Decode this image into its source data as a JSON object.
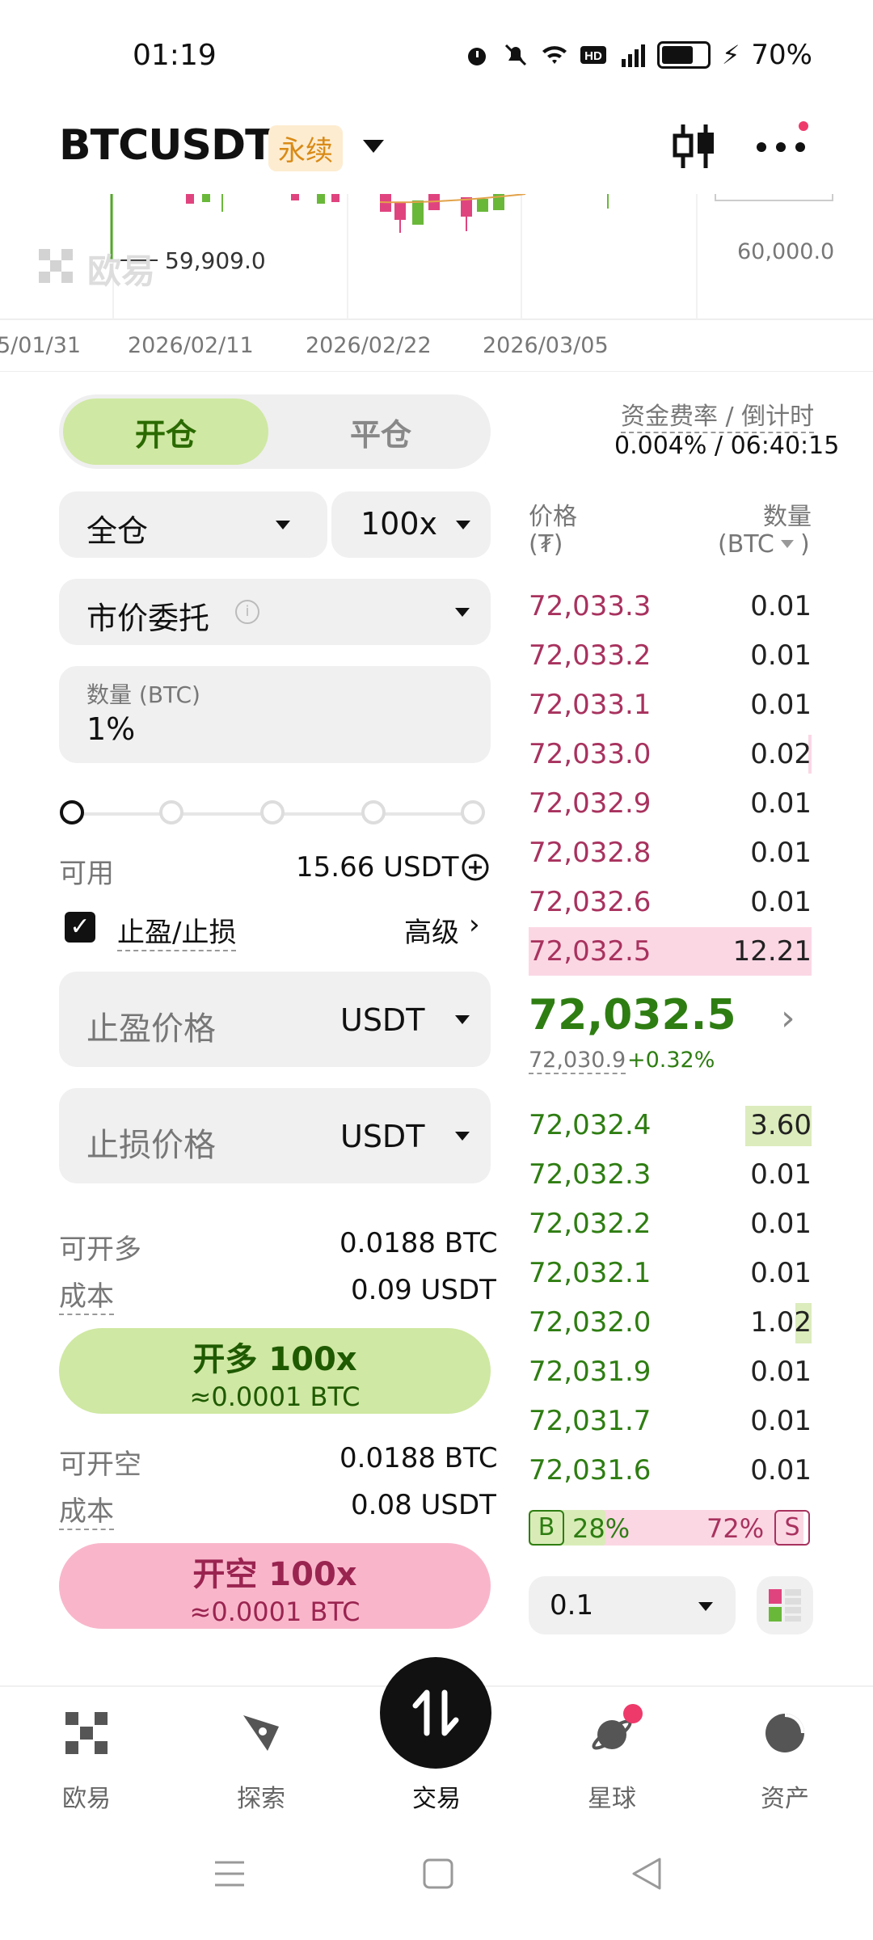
{
  "status": {
    "time": "01:19",
    "battery": "70%"
  },
  "header": {
    "pair": "BTCUSDT",
    "type_badge": "永续"
  },
  "chart": {
    "low_label": "59,909.0",
    "price_tick": "60,000.0",
    "date_ticks": [
      "5/01/31",
      "2026/02/11",
      "2026/02/22",
      "2026/03/05"
    ],
    "watermark": "欧易"
  },
  "form": {
    "tab_open": "开仓",
    "tab_close": "平仓",
    "margin_mode": "全仓",
    "leverage": "100x",
    "order_type": "市价委托",
    "qty_label": "数量 (BTC)",
    "qty_value": "1%",
    "slider_percent": 0,
    "available_label": "可用",
    "available_value": "15.66 USDT",
    "tpsl_label": "止盈/止损",
    "tpsl_checked": true,
    "advanced": "高级",
    "tp_placeholder": "止盈价格",
    "tp_unit": "USDT",
    "sl_placeholder": "止损价格",
    "sl_unit": "USDT",
    "can_long_label": "可开多",
    "can_long_value": "0.0188 BTC",
    "cost_label": "成本",
    "long_cost": "0.09 USDT",
    "long_btn": "开多 100x",
    "long_btn_sub": "≈0.0001 BTC",
    "can_short_label": "可开空",
    "can_short_value": "0.0188 BTC",
    "short_cost": "0.08 USDT",
    "short_btn": "开空 100x",
    "short_btn_sub": "≈0.0001 BTC"
  },
  "orderbook": {
    "funding_label": "资金费率 / 倒计时",
    "funding_value": "0.004% / 06:40:15",
    "price_header": "价格",
    "price_unit": "(₮)",
    "qty_header": "数量",
    "qty_unit": "(BTC",
    "asks": [
      {
        "price": "72,033.3",
        "qty": "0.01"
      },
      {
        "price": "72,033.2",
        "qty": "0.01"
      },
      {
        "price": "72,033.1",
        "qty": "0.01"
      },
      {
        "price": "72,033.0",
        "qty": "0.02"
      },
      {
        "price": "72,032.9",
        "qty": "0.01"
      },
      {
        "price": "72,032.8",
        "qty": "0.01"
      },
      {
        "price": "72,032.6",
        "qty": "0.01"
      },
      {
        "price": "72,032.5",
        "qty": "12.21"
      }
    ],
    "last_price": "72,032.5",
    "mark_price": "72,030.9",
    "change": "+0.32%",
    "bids": [
      {
        "price": "72,032.4",
        "qty": "3.60"
      },
      {
        "price": "72,032.3",
        "qty": "0.01"
      },
      {
        "price": "72,032.2",
        "qty": "0.01"
      },
      {
        "price": "72,032.1",
        "qty": "0.01"
      },
      {
        "price": "72,032.0",
        "qty": "1.02"
      },
      {
        "price": "72,031.9",
        "qty": "0.01"
      },
      {
        "price": "72,031.7",
        "qty": "0.01"
      },
      {
        "price": "72,031.6",
        "qty": "0.01"
      }
    ],
    "buy_label": "B",
    "buy_pct": "28%",
    "sell_pct": "72%",
    "sell_label": "S",
    "buy_ratio": 0.28,
    "tick_size": "0.1"
  },
  "nav": {
    "items": [
      {
        "label": "欧易",
        "icon": "okx-logo-icon"
      },
      {
        "label": "探索",
        "icon": "compass-icon"
      },
      {
        "label": "交易",
        "icon": "trade-swap-icon"
      },
      {
        "label": "星球",
        "icon": "planet-icon"
      },
      {
        "label": "资产",
        "icon": "pie-chart-icon"
      }
    ]
  },
  "colors": {
    "ask": "#a8325e",
    "bid": "#2e7d12",
    "long_btn": "#cfe8a3",
    "short_btn": "#f9b6cb"
  }
}
